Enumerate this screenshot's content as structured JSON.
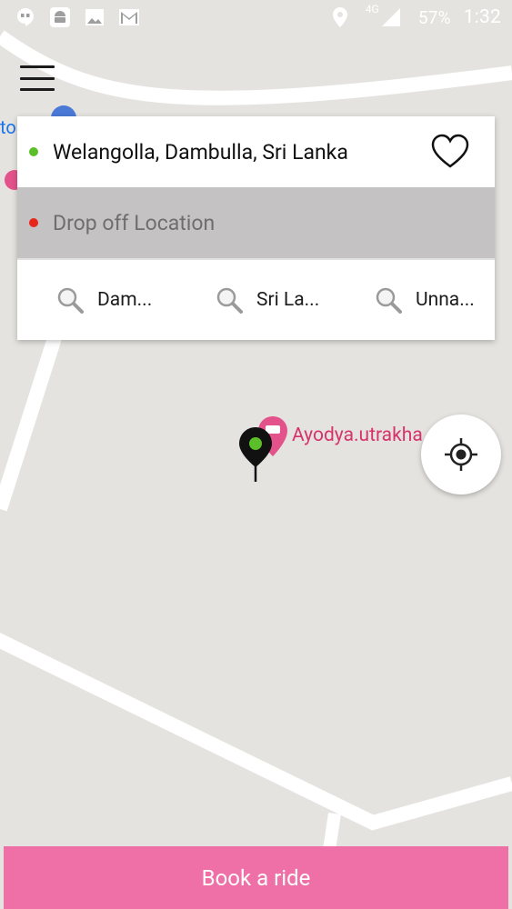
{
  "status_bar": {
    "network": "4G",
    "battery": "57%",
    "time": "1:32",
    "left_icons": [
      "hangouts-icon",
      "android-icon",
      "image-icon",
      "gmail-icon"
    ],
    "right_icons": [
      "location-icon",
      "signal-icon"
    ]
  },
  "map": {
    "fragment_text": "to",
    "place_label": "Ayodya.utrakha",
    "background": "#e5e3df",
    "road_color": "#ffffff"
  },
  "search": {
    "pickup": "Welangolla, Dambulla, Sri Lanka",
    "dropoff_placeholder": "Drop off Location",
    "recents": [
      {
        "label": "Dam..."
      },
      {
        "label": "Sri La..."
      },
      {
        "label": "Unna..."
      }
    ]
  },
  "actions": {
    "book_label": "Book a ride"
  },
  "colors": {
    "accent": "#ef6fa7",
    "pickup_dot": "#5cbf2a",
    "dropoff_dot": "#e8251c",
    "place_label": "#d6336c"
  }
}
